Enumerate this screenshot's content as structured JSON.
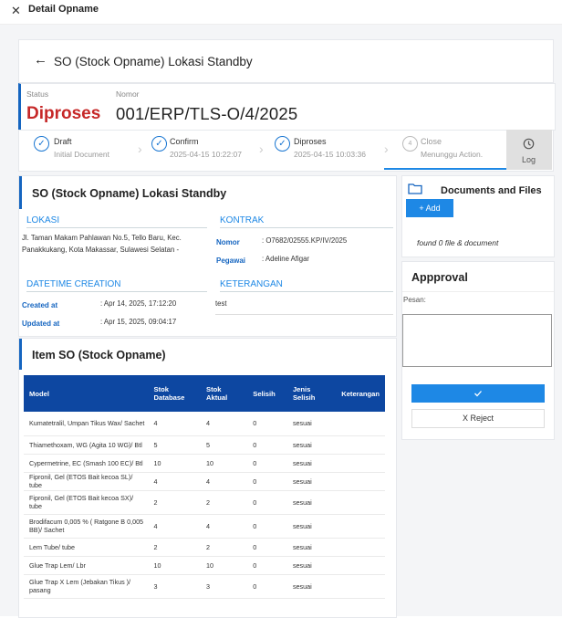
{
  "window": {
    "title": "Detail Opname"
  },
  "header": {
    "title": "SO (Stock Opname) Lokasi Standby"
  },
  "status": {
    "status_label": "Status",
    "status_value": "Diproses",
    "nomor_label": "Nomor",
    "nomor_value": "001/ERP/TLS-O/4/2025"
  },
  "steps": [
    {
      "name": "Draft",
      "sub": "Initial Document",
      "state": "done"
    },
    {
      "name": "Confirm",
      "sub": "2025-04-15 10:22:07",
      "state": "done"
    },
    {
      "name": "Diproses",
      "sub": "2025-04-15 10:03:36",
      "state": "done"
    },
    {
      "name": "Close",
      "sub": "Menunggu Action.",
      "state": "pending",
      "num": "4"
    }
  ],
  "log_label": "Log",
  "detail": {
    "title": "SO (Stock Opname) Lokasi Standby",
    "lokasi_title": "LOKASI",
    "lokasi_value": "Jl. Taman Makam Pahlawan No.5, Tello Baru, Kec. Panakkukang, Kota Makassar, Sulawesi Selatan -",
    "kontrak_title": "KONTRAK",
    "nomor_label": "Nomor",
    "nomor_value": ": O7682/02555.KP/IV/2025",
    "pegawai_label": "Pegawai",
    "pegawai_value": ": Adeline Afigar",
    "datetime_title": "DATETIME CREATION",
    "created_label": "Created at",
    "created_value": ": Apr 14, 2025, 17:12:20",
    "updated_label": "Updated at",
    "updated_value": ": Apr 15, 2025, 09:04:17",
    "keterangan_title": "KETERANGAN",
    "keterangan_value": "test"
  },
  "items": {
    "title": "Item SO (Stock Opname)",
    "headers": [
      "Model",
      "Stok Database",
      "Stok Aktual",
      "Selisih",
      "Jenis Selisih",
      "Keterangan"
    ],
    "rows": [
      [
        "Kumatetralil, Umpan Tikus Wax/ Sachet",
        "4",
        "4",
        "0",
        "sesuai",
        ""
      ],
      [
        "Thiamethoxam, WG (Agita 10 WG)/ Btl",
        "5",
        "5",
        "0",
        "sesuai",
        ""
      ],
      [
        "Cypermetrine, EC (Smash 100 EC)/ Btl",
        "10",
        "10",
        "0",
        "sesuai",
        ""
      ],
      [
        "Fipronil, Gel (ETOS Bait kecoa SL)/ tube",
        "4",
        "4",
        "0",
        "sesuai",
        ""
      ],
      [
        "Fipronil, Gel (ETOS Bait kecoa SX)/ tube",
        "2",
        "2",
        "0",
        "sesuai",
        ""
      ],
      [
        "Brodifacum 0,005 % ( Ratgone B 0,005 BB)/ Sachet",
        "4",
        "4",
        "0",
        "sesuai",
        ""
      ],
      [
        "Lem Tube/ tube",
        "2",
        "2",
        "0",
        "sesuai",
        ""
      ],
      [
        "Glue Trap Lem/ Lbr",
        "10",
        "10",
        "0",
        "sesuai",
        ""
      ],
      [
        "Glue Trap X Lem (Jebakan Tikus )/ pasang",
        "3",
        "3",
        "0",
        "sesuai",
        ""
      ]
    ]
  },
  "documents": {
    "title": "Documents and Files",
    "add_label": "+ Add",
    "empty_text": "found 0 file & document"
  },
  "approval": {
    "title": "Appproval",
    "pesan_label": "Pesan:",
    "pesan_value": "",
    "approve_icon": "check-icon",
    "reject_label": "X  Reject"
  }
}
